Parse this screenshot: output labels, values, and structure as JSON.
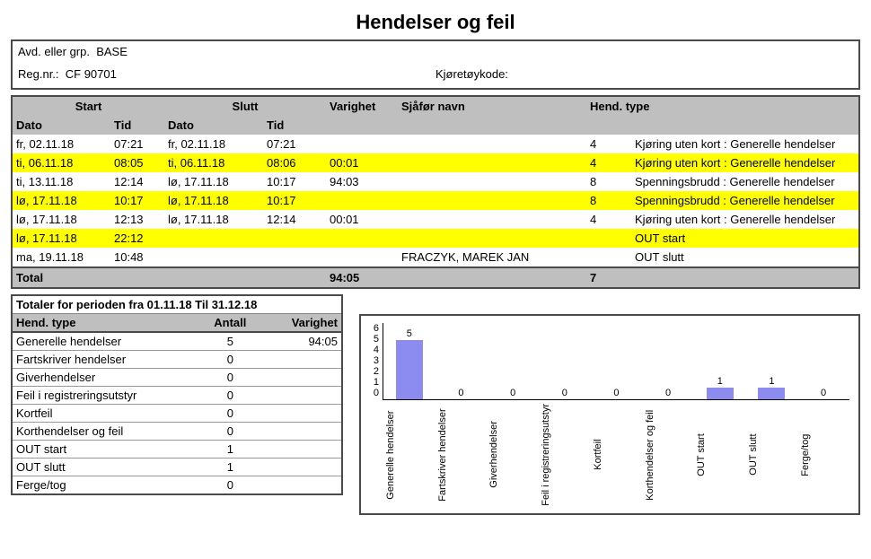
{
  "title": "Hendelser og feil",
  "info": {
    "dept_label": "Avd. eller grp.",
    "dept_value": "BASE",
    "reg_label": "Reg.nr.:",
    "reg_value": "CF 90701",
    "vehcode_label": "Kjøretøykode:",
    "vehcode_value": ""
  },
  "headers": {
    "start": "Start",
    "slutt": "Slutt",
    "dato": "Dato",
    "tid": "Tid",
    "varighet": "Varighet",
    "sjafor": "Sjåfør navn",
    "hendtype": "Hend. type"
  },
  "rows": [
    {
      "hl": false,
      "sd": "fr, 02.11.18",
      "st": "07:21",
      "ed": "fr, 02.11.18",
      "et": "07:21",
      "dur": "",
      "drv": "",
      "code": "4",
      "desc": "Kjøring uten kort : Generelle hendelser"
    },
    {
      "hl": true,
      "sd": "ti, 06.11.18",
      "st": "08:05",
      "ed": "ti, 06.11.18",
      "et": "08:06",
      "dur": "00:01",
      "drv": "",
      "code": "4",
      "desc": "Kjøring uten kort : Generelle hendelser"
    },
    {
      "hl": false,
      "sd": "ti, 13.11.18",
      "st": "12:14",
      "ed": "lø, 17.11.18",
      "et": "10:17",
      "dur": "94:03",
      "drv": "",
      "code": "8",
      "desc": "Spenningsbrudd : Generelle hendelser"
    },
    {
      "hl": true,
      "sd": "lø, 17.11.18",
      "st": "10:17",
      "ed": "lø, 17.11.18",
      "et": "10:17",
      "dur": "",
      "drv": "",
      "code": "8",
      "desc": "Spenningsbrudd : Generelle hendelser"
    },
    {
      "hl": false,
      "sd": "lø, 17.11.18",
      "st": "12:13",
      "ed": "lø, 17.11.18",
      "et": "12:14",
      "dur": "00:01",
      "drv": "",
      "code": "4",
      "desc": "Kjøring uten kort : Generelle hendelser"
    },
    {
      "hl": true,
      "sd": "lø, 17.11.18",
      "st": "22:12",
      "ed": "",
      "et": "",
      "dur": "",
      "drv": "",
      "code": "",
      "desc": "OUT start"
    },
    {
      "hl": false,
      "sd": "ma, 19.11.18",
      "st": "10:48",
      "ed": "",
      "et": "",
      "dur": "",
      "drv": "FRACZYK, MAREK JAN",
      "code": "",
      "desc": "OUT slutt"
    }
  ],
  "total": {
    "label": "Total",
    "dur": "94:05",
    "count": "7"
  },
  "summary": {
    "title": "Totaler for perioden fra 01.11.18 Til 31.12.18",
    "col_type": "Hend. type",
    "col_count": "Antall",
    "col_dur": "Varighet",
    "rows": [
      {
        "t": "Generelle hendelser",
        "a": "5",
        "v": "94:05"
      },
      {
        "t": "Fartskriver hendelser",
        "a": "0",
        "v": ""
      },
      {
        "t": "Giverhendelser",
        "a": "0",
        "v": ""
      },
      {
        "t": "Feil i registreringsutstyr",
        "a": "0",
        "v": ""
      },
      {
        "t": "Kortfeil",
        "a": "0",
        "v": ""
      },
      {
        "t": "Korthendelser og feil",
        "a": "0",
        "v": ""
      },
      {
        "t": "OUT start",
        "a": "1",
        "v": ""
      },
      {
        "t": "OUT slutt",
        "a": "1",
        "v": ""
      },
      {
        "t": "Ferge/tog",
        "a": "0",
        "v": ""
      }
    ]
  },
  "chart_data": {
    "type": "bar",
    "categories": [
      "Generelle hendelser",
      "Fartskriver hendelser",
      "Giverhendelser",
      "Feil i registreringsutstyr",
      "Kortfeil",
      "Korthendelser og feil",
      "OUT start",
      "OUT slutt",
      "Ferge/tog"
    ],
    "values": [
      5,
      0,
      0,
      0,
      0,
      0,
      1,
      1,
      0
    ],
    "ylim": [
      0,
      6
    ],
    "yticks": [
      "6",
      "5",
      "4",
      "3",
      "2",
      "1",
      "0"
    ],
    "title": "",
    "xlabel": "",
    "ylabel": ""
  }
}
